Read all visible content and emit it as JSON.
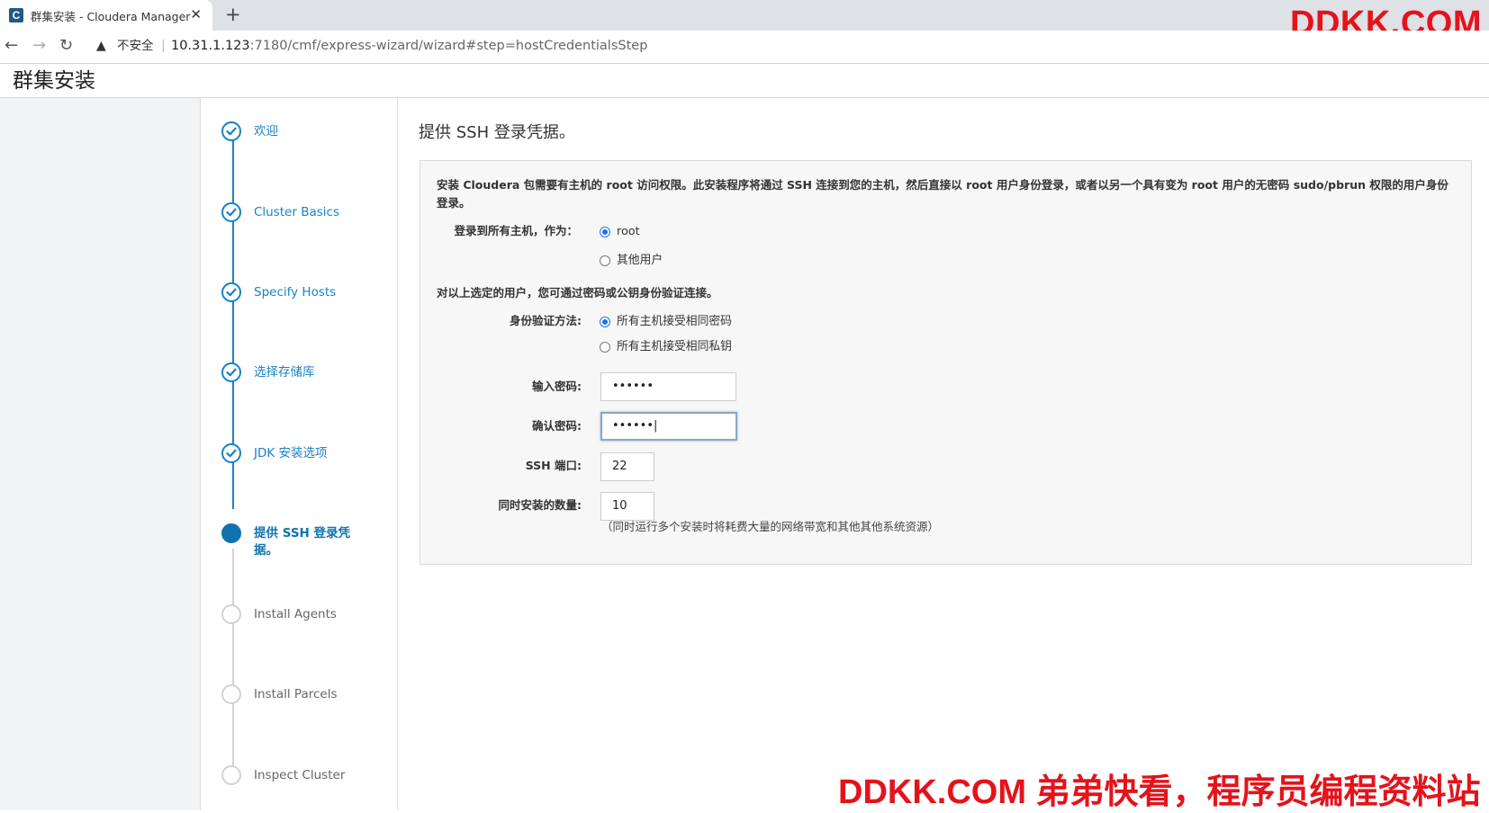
{
  "browser": {
    "tab_title": "群集安装 - Cloudera Manager",
    "favicon_letter": "C",
    "close_glyph": "✕",
    "new_tab_glyph": "+",
    "nav": {
      "back": "←",
      "forward": "→",
      "reload": "↻"
    },
    "security_icon": "▲",
    "security_label": "不安全",
    "separator": "|",
    "url_host": "10.31.1.123",
    "url_rest": ":7180/cmf/express-wizard/wizard#step=hostCredentialsStep"
  },
  "watermark": {
    "top": "DDKK.COM",
    "bottom": "DDKK.COM 弟弟快看，程序员编程资料站"
  },
  "page": {
    "title": "群集安装"
  },
  "steps": [
    {
      "label": "欢迎",
      "state": "done"
    },
    {
      "label": "Cluster Basics",
      "state": "done"
    },
    {
      "label": "Specify Hosts",
      "state": "done"
    },
    {
      "label": "选择存储库",
      "state": "done"
    },
    {
      "label": "JDK 安装选项",
      "state": "done"
    },
    {
      "label": "提供 SSH 登录凭据。",
      "state": "active"
    },
    {
      "label": "Install Agents",
      "state": "todo"
    },
    {
      "label": "Install Parcels",
      "state": "todo"
    },
    {
      "label": "Inspect Cluster",
      "state": "todo"
    }
  ],
  "form": {
    "heading": "提供 SSH 登录凭据。",
    "description": "安装 Cloudera 包需要有主机的 root 访问权限。此安装程序将通过 SSH 连接到您的主机，然后直接以 root 用户身份登录，或者以另一个具有变为 root 用户的无密码 sudo/pbrun 权限的用户身份登录。",
    "login_label": "登录到所有主机，作为：",
    "login_options": [
      {
        "label": "root",
        "selected": true
      },
      {
        "label": "其他用户",
        "selected": false
      }
    ],
    "auth_intro": "对以上选定的用户，您可通过密码或公钥身份验证连接。",
    "auth_label": "身份验证方法:",
    "auth_options": [
      {
        "label": "所有主机接受相同密码",
        "selected": true
      },
      {
        "label": "所有主机接受相同私钥",
        "selected": false
      }
    ],
    "password_label": "输入密码:",
    "password_value": "••••••",
    "confirm_label": "确认密码:",
    "confirm_value": "••••••|",
    "ssh_port_label": "SSH 端口:",
    "ssh_port_value": "22",
    "parallel_label": "同时安装的数量:",
    "parallel_value": "10",
    "parallel_hint": "（同时运行多个安装时将耗费大量的网络带宽和其他其他系统资源）"
  },
  "colors": {
    "accent": "#1a82c4",
    "active_step": "#1073b0",
    "watermark": "#e4131b"
  }
}
